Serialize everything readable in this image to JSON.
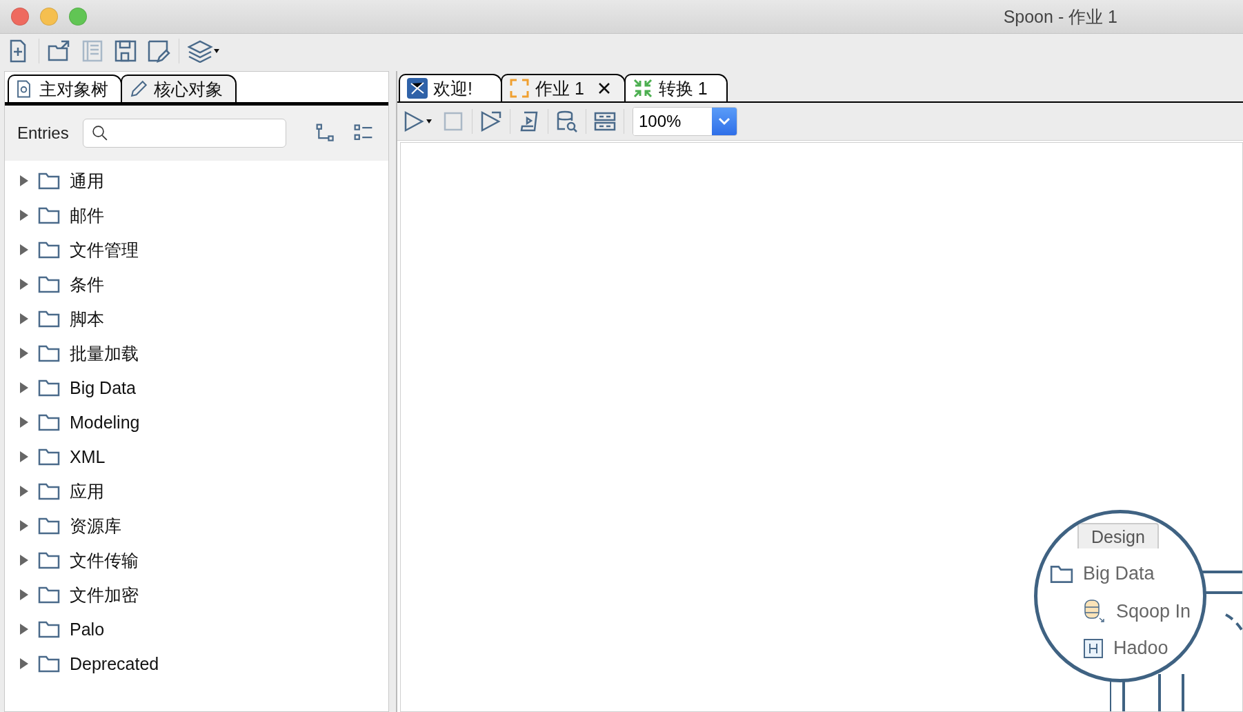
{
  "window": {
    "title": "Spoon - 作业 1"
  },
  "left_panel": {
    "tabs": [
      {
        "label": "主对象树",
        "selected": false
      },
      {
        "label": "核心对象",
        "selected": true
      }
    ],
    "filter_label": "Entries",
    "tree": [
      {
        "label": "通用",
        "expanded": false
      },
      {
        "label": "邮件",
        "expanded": false
      },
      {
        "label": "文件管理",
        "expanded": false
      },
      {
        "label": "条件",
        "expanded": false
      },
      {
        "label": "脚本",
        "expanded": false
      },
      {
        "label": "批量加载",
        "expanded": false
      },
      {
        "label": "Big Data",
        "expanded": false
      },
      {
        "label": "Modeling",
        "expanded": false
      },
      {
        "label": "XML",
        "expanded": false
      },
      {
        "label": "应用",
        "expanded": false
      },
      {
        "label": "资源库",
        "expanded": false
      },
      {
        "label": "文件传输",
        "expanded": false
      },
      {
        "label": "文件加密",
        "expanded": false
      },
      {
        "label": "Palo",
        "expanded": false
      },
      {
        "label": "Deprecated",
        "expanded": false
      }
    ]
  },
  "editor": {
    "tabs": [
      {
        "label": "欢迎!",
        "selected": false
      },
      {
        "label": "作业 1",
        "selected": true
      },
      {
        "label": "转换 1",
        "selected": false
      }
    ],
    "zoom": "100%",
    "illustration": {
      "tab": "Design",
      "items": [
        {
          "kind": "folder",
          "label": "Big Data"
        },
        {
          "kind": "database",
          "label": "Sqoop In"
        },
        {
          "kind": "hadoop",
          "label": "Hadoo"
        }
      ]
    }
  }
}
